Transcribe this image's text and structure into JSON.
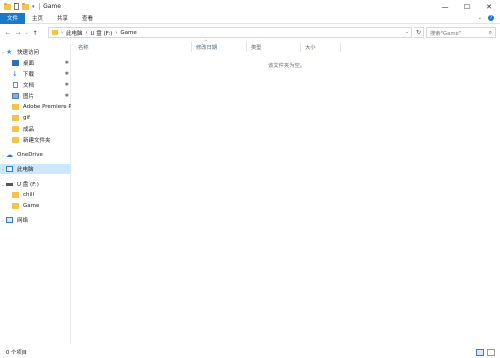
{
  "titlebar": {
    "dropdown_glyph": "▾",
    "separator": "|",
    "title": "Game",
    "buttons": {
      "minimize": "—",
      "maximize": "☐",
      "close": "✕"
    }
  },
  "ribbon": {
    "tabs": [
      "文件",
      "主页",
      "共享",
      "查看"
    ],
    "expand_glyph": "⌄",
    "help_glyph": "?"
  },
  "nav": {
    "back": "←",
    "forward": "→",
    "recent": "⌄",
    "up": "↑",
    "breadcrumb": [
      "此电脑",
      "U 盘 (F:)",
      "Game"
    ],
    "chevron": "›",
    "address_dropdown": "⌄",
    "refresh": "↻",
    "search_placeholder": "搜索\"Game\"",
    "search_icon": "⌕"
  },
  "sidebar": {
    "items": [
      {
        "label": "快速访问",
        "icon": "star-icon",
        "expand": "›"
      },
      {
        "label": "桌面",
        "icon": "desktop-icon",
        "pinned": true
      },
      {
        "label": "下载",
        "icon": "download-icon",
        "pinned": true
      },
      {
        "label": "文档",
        "icon": "documents-icon",
        "pinned": true
      },
      {
        "label": "图片",
        "icon": "pictures-icon",
        "pinned": true
      },
      {
        "label": "Adobe Premiere P",
        "icon": "folder-icon"
      },
      {
        "label": "gif",
        "icon": "folder-icon"
      },
      {
        "label": "成品",
        "icon": "folder-icon"
      },
      {
        "label": "新建文件夹",
        "icon": "folder-icon"
      },
      {
        "label": "OneDrive",
        "icon": "onedrive-icon",
        "expand": "›"
      },
      {
        "label": "此电脑",
        "icon": "this-pc-icon",
        "expand": "›",
        "selected": true
      },
      {
        "label": "U 盘 (F:)",
        "icon": "usb-drive-icon",
        "expand": "⌄"
      },
      {
        "label": "chill",
        "icon": "folder-icon"
      },
      {
        "label": "Game",
        "icon": "folder-icon"
      },
      {
        "label": "网络",
        "icon": "network-icon",
        "expand": "›"
      }
    ],
    "pin_glyph": "✱"
  },
  "columns": {
    "name": "名称",
    "date": "修改日期",
    "type": "类型",
    "size": "大小",
    "sort_glyph": "^"
  },
  "content": {
    "empty_message": "该文件夹为空。"
  },
  "status": {
    "item_count": "0 个项目"
  },
  "colors": {
    "accent": "#1979ca",
    "selection": "#cce8ff"
  }
}
